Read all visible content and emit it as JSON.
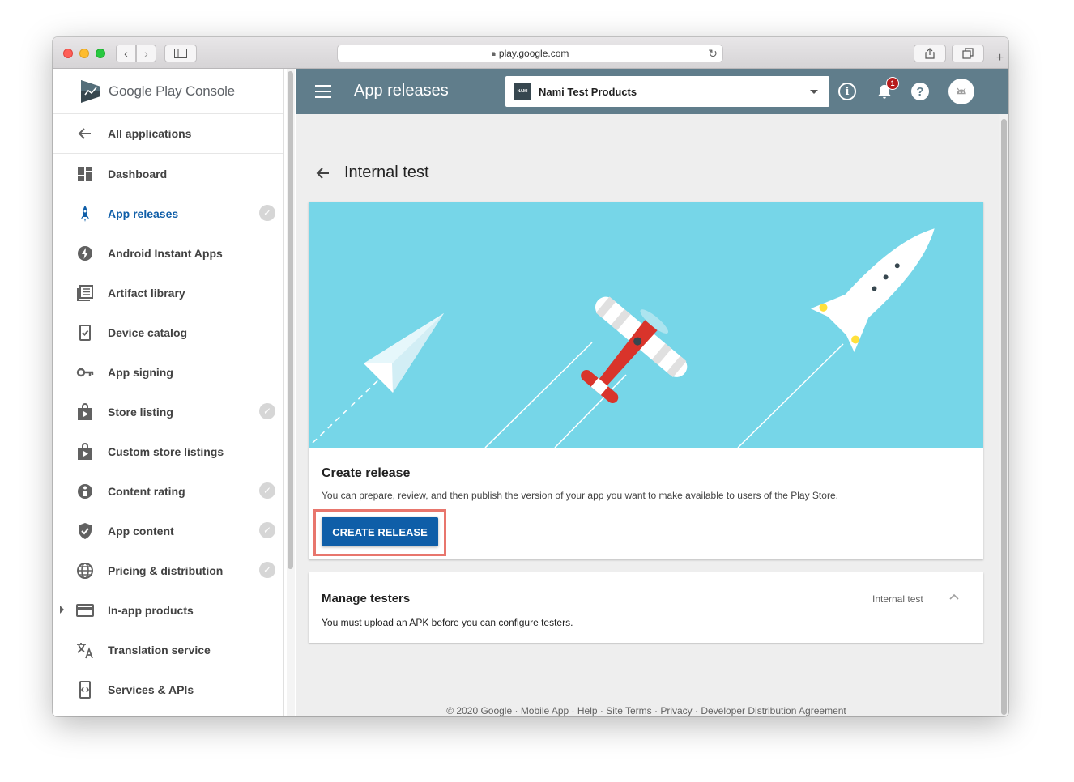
{
  "browser": {
    "url": "play.google.com"
  },
  "logo": {
    "brand": "Google Play",
    "product": "Console"
  },
  "leftnav": {
    "back_label": "All applications",
    "items": [
      {
        "label": "Dashboard",
        "icon": "dashboard-icon",
        "checked": false,
        "active": false
      },
      {
        "label": "App releases",
        "icon": "rocket-icon",
        "checked": true,
        "active": true
      },
      {
        "label": "Android Instant Apps",
        "icon": "bolt-icon",
        "checked": false,
        "active": false
      },
      {
        "label": "Artifact library",
        "icon": "library-icon",
        "checked": false,
        "active": false
      },
      {
        "label": "Device catalog",
        "icon": "device-catalog-icon",
        "checked": false,
        "active": false
      },
      {
        "label": "App signing",
        "icon": "key-icon",
        "checked": false,
        "active": false
      },
      {
        "label": "Store listing",
        "icon": "store-icon",
        "checked": true,
        "active": false
      },
      {
        "label": "Custom store listings",
        "icon": "store-icon",
        "checked": false,
        "active": false
      },
      {
        "label": "Content rating",
        "icon": "rating-icon",
        "checked": true,
        "active": false
      },
      {
        "label": "App content",
        "icon": "shield-icon",
        "checked": true,
        "active": false
      },
      {
        "label": "Pricing & distribution",
        "icon": "globe-icon",
        "checked": true,
        "active": false
      },
      {
        "label": "In-app products",
        "icon": "card-icon",
        "checked": false,
        "active": false,
        "expandable": true
      },
      {
        "label": "Translation service",
        "icon": "translate-icon",
        "checked": false,
        "active": false
      },
      {
        "label": "Services & APIs",
        "icon": "api-icon",
        "checked": false,
        "active": false
      }
    ]
  },
  "topbar": {
    "title": "App releases",
    "app_name": "Nami Test Products",
    "app_icon_text": "NAMI",
    "notification_count": "1"
  },
  "page": {
    "title": "Internal test"
  },
  "create_card": {
    "title": "Create release",
    "description": "You can prepare, review, and then publish the version of your app you want to make available to users of the Play Store.",
    "button_label": "CREATE RELEASE"
  },
  "testers_card": {
    "title": "Manage testers",
    "track": "Internal test",
    "description": "You must upload an APK before you can configure testers."
  },
  "footer": {
    "text": "© 2020 Google · Mobile App · Help · Site Terms · Privacy · Developer Distribution Agreement"
  },
  "colors": {
    "topbar": "#607d8b",
    "accent": "#0f5ea8",
    "hero": "#76d6e8",
    "highlight": "#e8766d"
  }
}
